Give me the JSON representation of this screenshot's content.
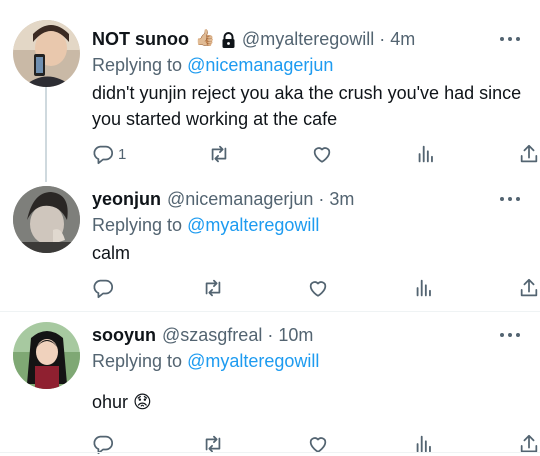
{
  "tweets": [
    {
      "name": "NOT sunoo",
      "name_emoji": "👍🏼",
      "handle": "@myalteregowill",
      "separator": "·",
      "time": "4m",
      "replying_prefix": "Replying to",
      "replying_to": "@nicemanagerjun",
      "text": "didn't yunjin reject you aka the crush you've had since you started working at the cafe",
      "reply_count": "1"
    },
    {
      "name": "yeonjun",
      "handle": "@nicemanagerjun",
      "separator": "·",
      "time": "3m",
      "replying_prefix": "Replying to",
      "replying_to": "@myalteregowill",
      "text": "calm",
      "reply_count": ""
    },
    {
      "name": "sooyun",
      "handle": "@szasgfreal",
      "separator": "·",
      "time": "10m",
      "replying_prefix": "Replying to",
      "replying_to": "@myalteregowill",
      "text": "ohur",
      "text_emoji": "😟",
      "reply_count": ""
    }
  ],
  "icons": {
    "reply": "reply-icon",
    "retweet": "retweet-icon",
    "like": "heart-icon",
    "views": "analytics-icon",
    "share": "share-icon",
    "more": "more-icon",
    "lock": "lock-icon"
  },
  "colors": {
    "link": "#1d9bf0",
    "secondary": "#536471",
    "divider": "#eff3f4"
  }
}
